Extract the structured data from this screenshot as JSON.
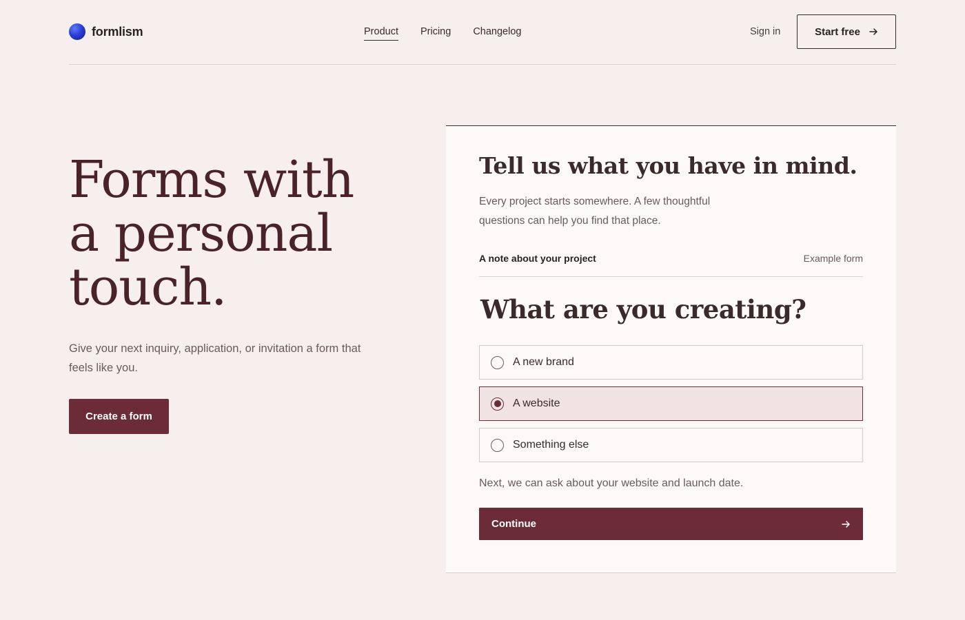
{
  "header": {
    "brand": "formlism",
    "nav": [
      "Product",
      "Pricing",
      "Changelog"
    ],
    "active_nav": "Product",
    "signin_label": "Sign in",
    "start_label": "Start free"
  },
  "hero": {
    "title_lines": [
      "Forms with",
      "a personal",
      "touch."
    ],
    "subtitle": "Give your next inquiry, application, or invitation a form that feels like you.",
    "cta_label": "Create a form"
  },
  "card": {
    "title": "Tell us what you have in mind.",
    "description": "Every project starts somewhere. A few thoughtful questions can help you find that place.",
    "note_label": "A note about your project",
    "note_tag": "Example form",
    "question": "What are you creating?",
    "options": [
      {
        "label": "A new brand",
        "selected": false
      },
      {
        "label": "A website",
        "selected": true
      },
      {
        "label": "Something else",
        "selected": false
      }
    ],
    "hint": "Next, we can ask about your website and launch date.",
    "continue_label": "Continue"
  },
  "colors": {
    "background": "#f7efed",
    "accent": "#6b2c38",
    "card": "#fdf9f8",
    "selected_option": "#f1e3e3"
  }
}
